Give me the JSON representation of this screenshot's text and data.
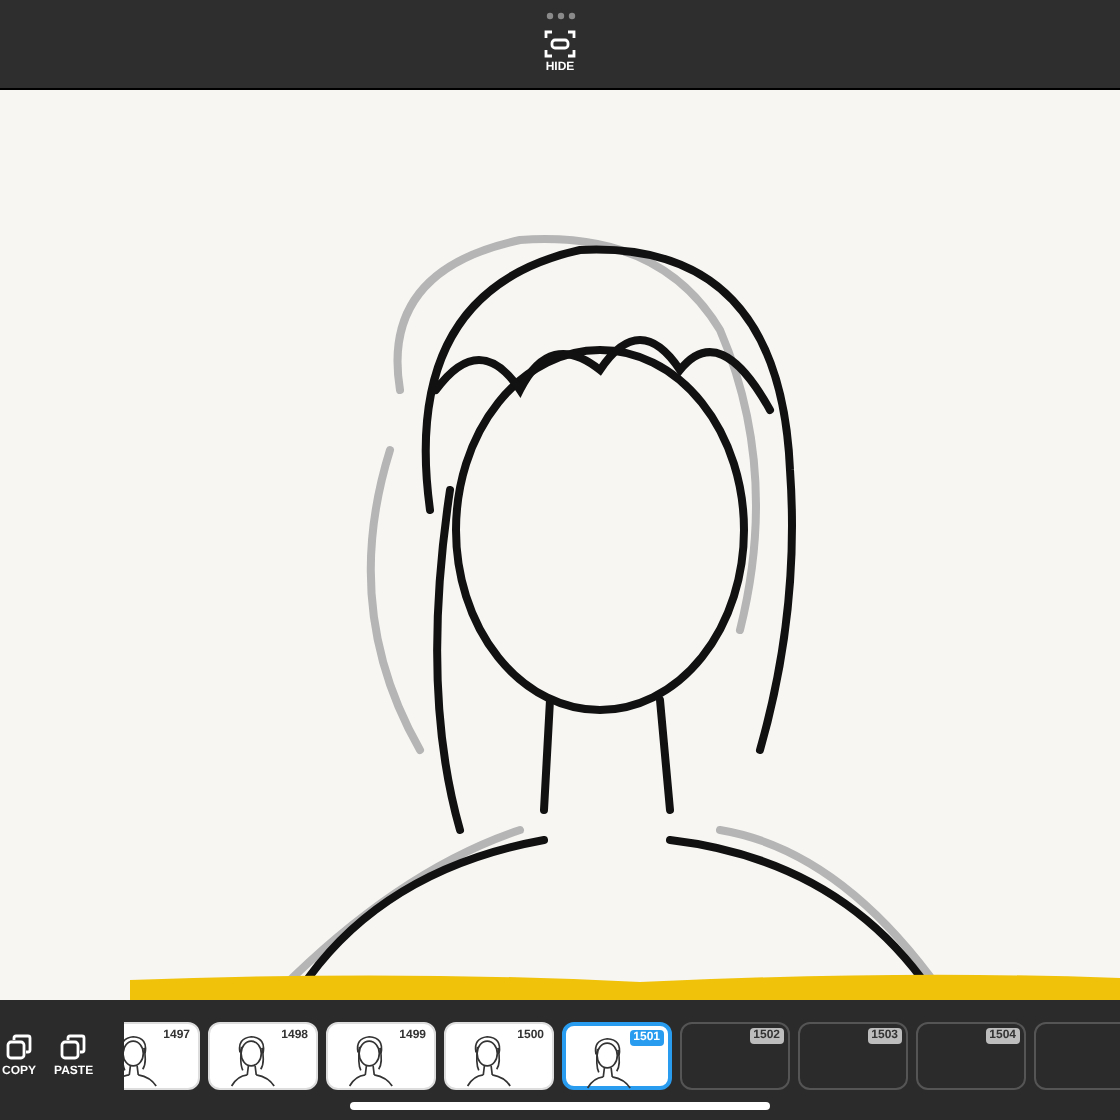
{
  "top_bar": {
    "hide_button": {
      "label": "HIDE"
    }
  },
  "actions": [
    {
      "label": "COPY"
    },
    {
      "label": "PASTE"
    }
  ],
  "frames": [
    {
      "number": "1497",
      "kind": "drawn",
      "selected": false
    },
    {
      "number": "1498",
      "kind": "drawn",
      "selected": false
    },
    {
      "number": "1499",
      "kind": "drawn",
      "selected": false
    },
    {
      "number": "1500",
      "kind": "drawn",
      "selected": false
    },
    {
      "number": "1501",
      "kind": "drawn",
      "selected": true
    },
    {
      "number": "1502",
      "kind": "empty",
      "selected": false
    },
    {
      "number": "1503",
      "kind": "empty",
      "selected": false
    },
    {
      "number": "1504",
      "kind": "empty",
      "selected": false
    }
  ]
}
